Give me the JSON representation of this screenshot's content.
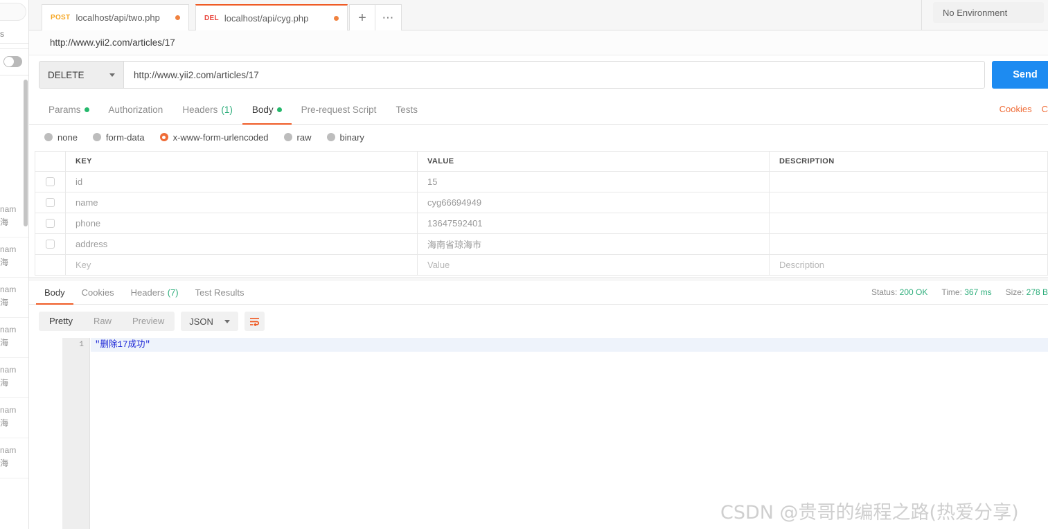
{
  "background_window": {
    "label": "s",
    "toggle_state": "off",
    "rows": [
      {
        "line1": "nam",
        "line2": "海"
      },
      {
        "line1": "nam",
        "line2": "海"
      },
      {
        "line1": "nam",
        "line2": "海"
      },
      {
        "line1": "nam",
        "line2": "海"
      },
      {
        "line1": "nam",
        "line2": "海"
      },
      {
        "line1": "nam",
        "line2": "海"
      },
      {
        "line1": "nam",
        "line2": "海"
      }
    ]
  },
  "tabbar": {
    "tabs": [
      {
        "method": "POST",
        "method_color": "#f5a623",
        "name": "localhost/api/two.php",
        "unsaved": true,
        "active": false
      },
      {
        "method": "DEL",
        "method_color": "#e8453c",
        "name": "localhost/api/cyg.php",
        "unsaved": true,
        "active": true
      }
    ],
    "new_tab_icon": "plus-icon",
    "more_icon": "ellipsis-icon",
    "environment": "No Environment"
  },
  "breadcrumb": {
    "title": "http://www.yii2.com/articles/17"
  },
  "request": {
    "method": "DELETE",
    "url": "http://www.yii2.com/articles/17",
    "send_label": "Send",
    "tabs": [
      {
        "label": "Params",
        "dot": true,
        "count": "",
        "active": false
      },
      {
        "label": "Authorization",
        "dot": false,
        "count": "",
        "active": false
      },
      {
        "label": "Headers",
        "dot": false,
        "count": "(1)",
        "active": false
      },
      {
        "label": "Body",
        "dot": true,
        "count": "",
        "active": true
      },
      {
        "label": "Pre-request Script",
        "dot": false,
        "count": "",
        "active": false
      },
      {
        "label": "Tests",
        "dot": false,
        "count": "",
        "active": false
      }
    ],
    "right_links": [
      "Cookies",
      "C"
    ],
    "body_types": [
      {
        "label": "none",
        "selected": false
      },
      {
        "label": "form-data",
        "selected": false
      },
      {
        "label": "x-www-form-urlencoded",
        "selected": true
      },
      {
        "label": "raw",
        "selected": false
      },
      {
        "label": "binary",
        "selected": false
      }
    ],
    "table": {
      "headers": [
        "KEY",
        "VALUE",
        "DESCRIPTION"
      ],
      "rows": [
        {
          "checked": false,
          "key": "id",
          "value": "15",
          "description": ""
        },
        {
          "checked": false,
          "key": "name",
          "value": "cyg66694949",
          "description": ""
        },
        {
          "checked": false,
          "key": "phone",
          "value": "13647592401",
          "description": ""
        },
        {
          "checked": false,
          "key": "address",
          "value": "海南省琼海市",
          "description": ""
        }
      ],
      "placeholder_row": {
        "key": "Key",
        "value": "Value",
        "description": "Description"
      }
    }
  },
  "response": {
    "tabs": [
      {
        "label": "Body",
        "count": "",
        "active": true
      },
      {
        "label": "Cookies",
        "count": "",
        "active": false
      },
      {
        "label": "Headers",
        "count": "(7)",
        "active": false
      },
      {
        "label": "Test Results",
        "count": "",
        "active": false
      }
    ],
    "meta": {
      "status_label": "Status:",
      "status_value": "200 OK",
      "time_label": "Time:",
      "time_value": "367 ms",
      "size_label": "Size:",
      "size_value": "278 B"
    },
    "view_modes": [
      {
        "label": "Pretty",
        "active": true
      },
      {
        "label": "Raw",
        "active": false
      },
      {
        "label": "Preview",
        "active": false
      }
    ],
    "format": "JSON",
    "wrap_icon": "wrap-lines-icon",
    "body_lines": [
      {
        "number": "1",
        "text": "\"删除17成功\""
      }
    ]
  },
  "watermark": "CSDN @贵哥的编程之路(热爱分享)",
  "colors": {
    "accent_orange": "#ef5b25",
    "send_blue": "#1d8bf1",
    "success_green": "#2fae7c",
    "post_amber": "#f5a623",
    "delete_red": "#e8453c"
  }
}
